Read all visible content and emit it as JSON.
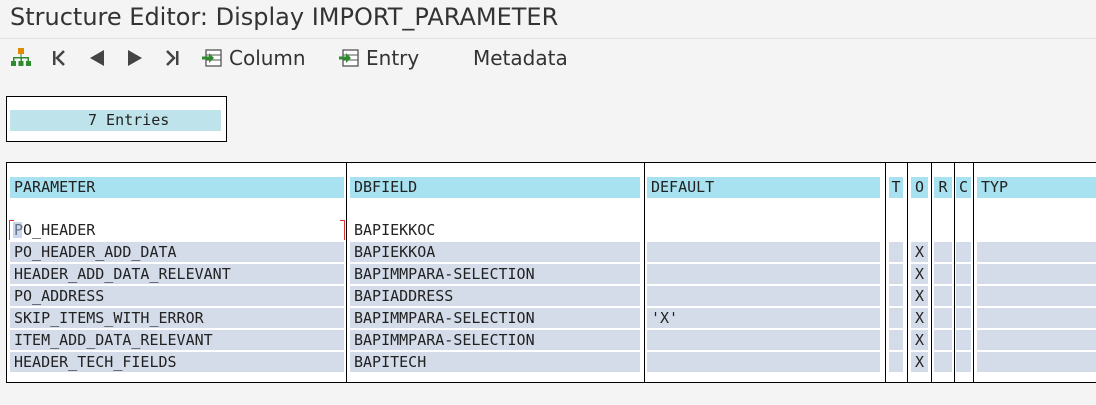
{
  "title": "Structure Editor: Display IMPORT_PARAMETER",
  "toolbar": {
    "column_label": "Column",
    "entry_label": "Entry",
    "metadata_label": "Metadata",
    "icons": [
      "hierarchy-icon",
      "first-page-icon",
      "previous-page-icon",
      "next-page-icon",
      "last-page-icon",
      "column-import-icon",
      "entry-import-icon"
    ]
  },
  "entries_count": "7 Entries",
  "table": {
    "headers": [
      "PARAMETER",
      "DBFIELD",
      "DEFAULT",
      "T",
      "O",
      "R",
      "C",
      "TYP"
    ],
    "rows": [
      {
        "parameter": "PO_HEADER",
        "dbfield": "BAPIEKKOC",
        "default": "",
        "t": "",
        "o": "",
        "r": "",
        "c": "",
        "typ": ""
      },
      {
        "parameter": "PO_HEADER_ADD_DATA",
        "dbfield": "BAPIEKKOA",
        "default": "",
        "t": "",
        "o": "X",
        "r": "",
        "c": "",
        "typ": ""
      },
      {
        "parameter": "HEADER_ADD_DATA_RELEVANT",
        "dbfield": "BAPIMMPARA-SELECTION",
        "default": "",
        "t": "",
        "o": "X",
        "r": "",
        "c": "",
        "typ": ""
      },
      {
        "parameter": "PO_ADDRESS",
        "dbfield": "BAPIADDRESS",
        "default": "",
        "t": "",
        "o": "X",
        "r": "",
        "c": "",
        "typ": ""
      },
      {
        "parameter": "SKIP_ITEMS_WITH_ERROR",
        "dbfield": "BAPIMMPARA-SELECTION",
        "default": "'X'",
        "t": "",
        "o": "X",
        "r": "",
        "c": "",
        "typ": ""
      },
      {
        "parameter": "ITEM_ADD_DATA_RELEVANT",
        "dbfield": "BAPIMMPARA-SELECTION",
        "default": "",
        "t": "",
        "o": "X",
        "r": "",
        "c": "",
        "typ": ""
      },
      {
        "parameter": "HEADER_TECH_FIELDS",
        "dbfield": "BAPITECH",
        "default": "",
        "t": "",
        "o": "X",
        "r": "",
        "c": "",
        "typ": ""
      }
    ]
  },
  "colors": {
    "header_cell": "#a8e1ef",
    "data_cell": "#d4dcea",
    "entries_cell": "#bfe3ea",
    "icon_green": "#2e8b2e",
    "icon_orange": "#e08a00"
  }
}
